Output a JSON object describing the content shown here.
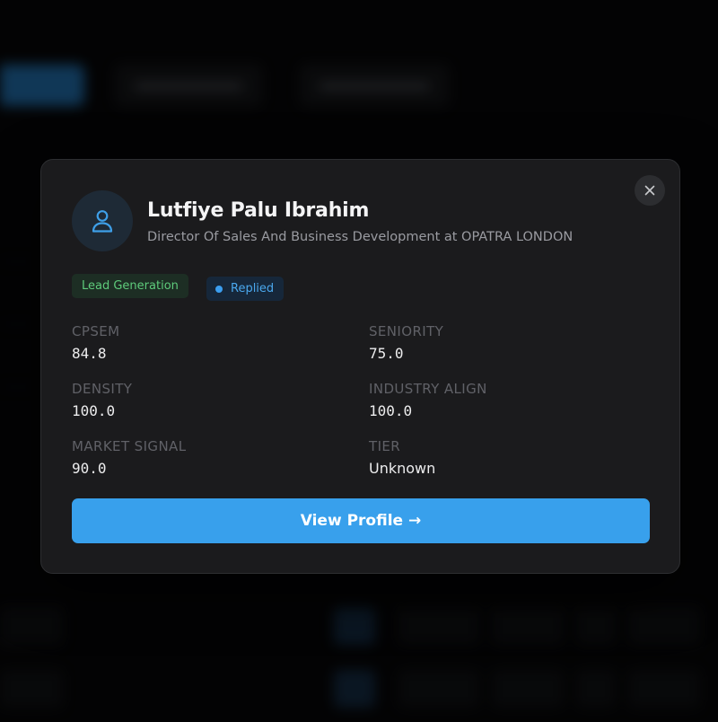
{
  "profile": {
    "name": "Lutfiye Palu Ibrahim",
    "title": "Director Of Sales And Business Development at OPATRA LONDON"
  },
  "badges": {
    "lead_generation": "Lead Generation",
    "status": "Replied"
  },
  "metrics": [
    {
      "label": "CPSEM",
      "value": "84.8"
    },
    {
      "label": "SENIORITY",
      "value": "75.0"
    },
    {
      "label": "DENSITY",
      "value": "100.0"
    },
    {
      "label": "INDUSTRY ALIGN",
      "value": "100.0"
    },
    {
      "label": "MARKET SIGNAL",
      "value": "90.0"
    },
    {
      "label": "TIER",
      "value": "Unknown"
    }
  ],
  "actions": {
    "view_profile": "View Profile →",
    "close": "✕"
  },
  "colors": {
    "accent": "#38a0ec",
    "lead_badge_text": "#5ecb7b",
    "replied_badge_text": "#4aa8ee",
    "modal_bg": "#1b1b1d"
  },
  "icons": {
    "avatar": "user-icon",
    "close": "close-icon",
    "status_dot": "dot-icon"
  }
}
